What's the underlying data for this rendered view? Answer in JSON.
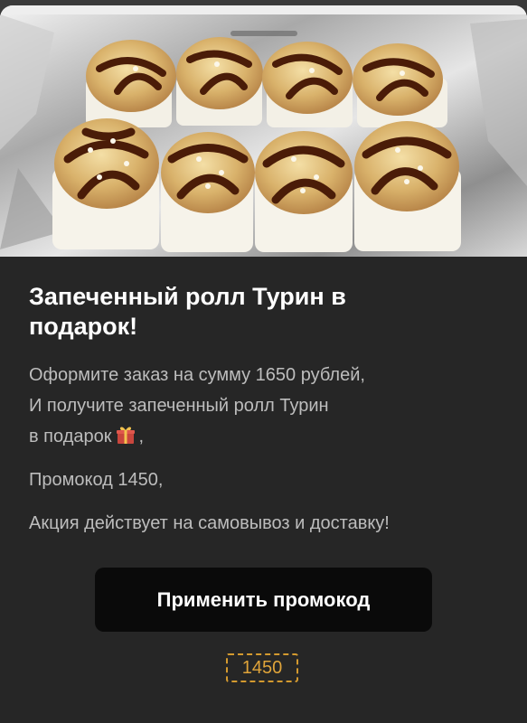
{
  "promo": {
    "title": "Запеченный ролл Турин в подарок!",
    "line1": "Оформите заказ на сумму 1650 рублей,",
    "line2": "И получите запеченный ролл Турин",
    "line3": "в подарок",
    "line3_suffix": ",",
    "gift_icon": "gift-emoji",
    "promo_line": "Промокод 1450,",
    "validity_line": "Акция действует на самовывоз и доставку!"
  },
  "apply_button": {
    "label": "Применить промокод"
  },
  "promo_code_chip": {
    "code": "1450"
  },
  "colors": {
    "background": "#262626",
    "button": "#0a0a0a",
    "accent": "#e0a43a"
  }
}
